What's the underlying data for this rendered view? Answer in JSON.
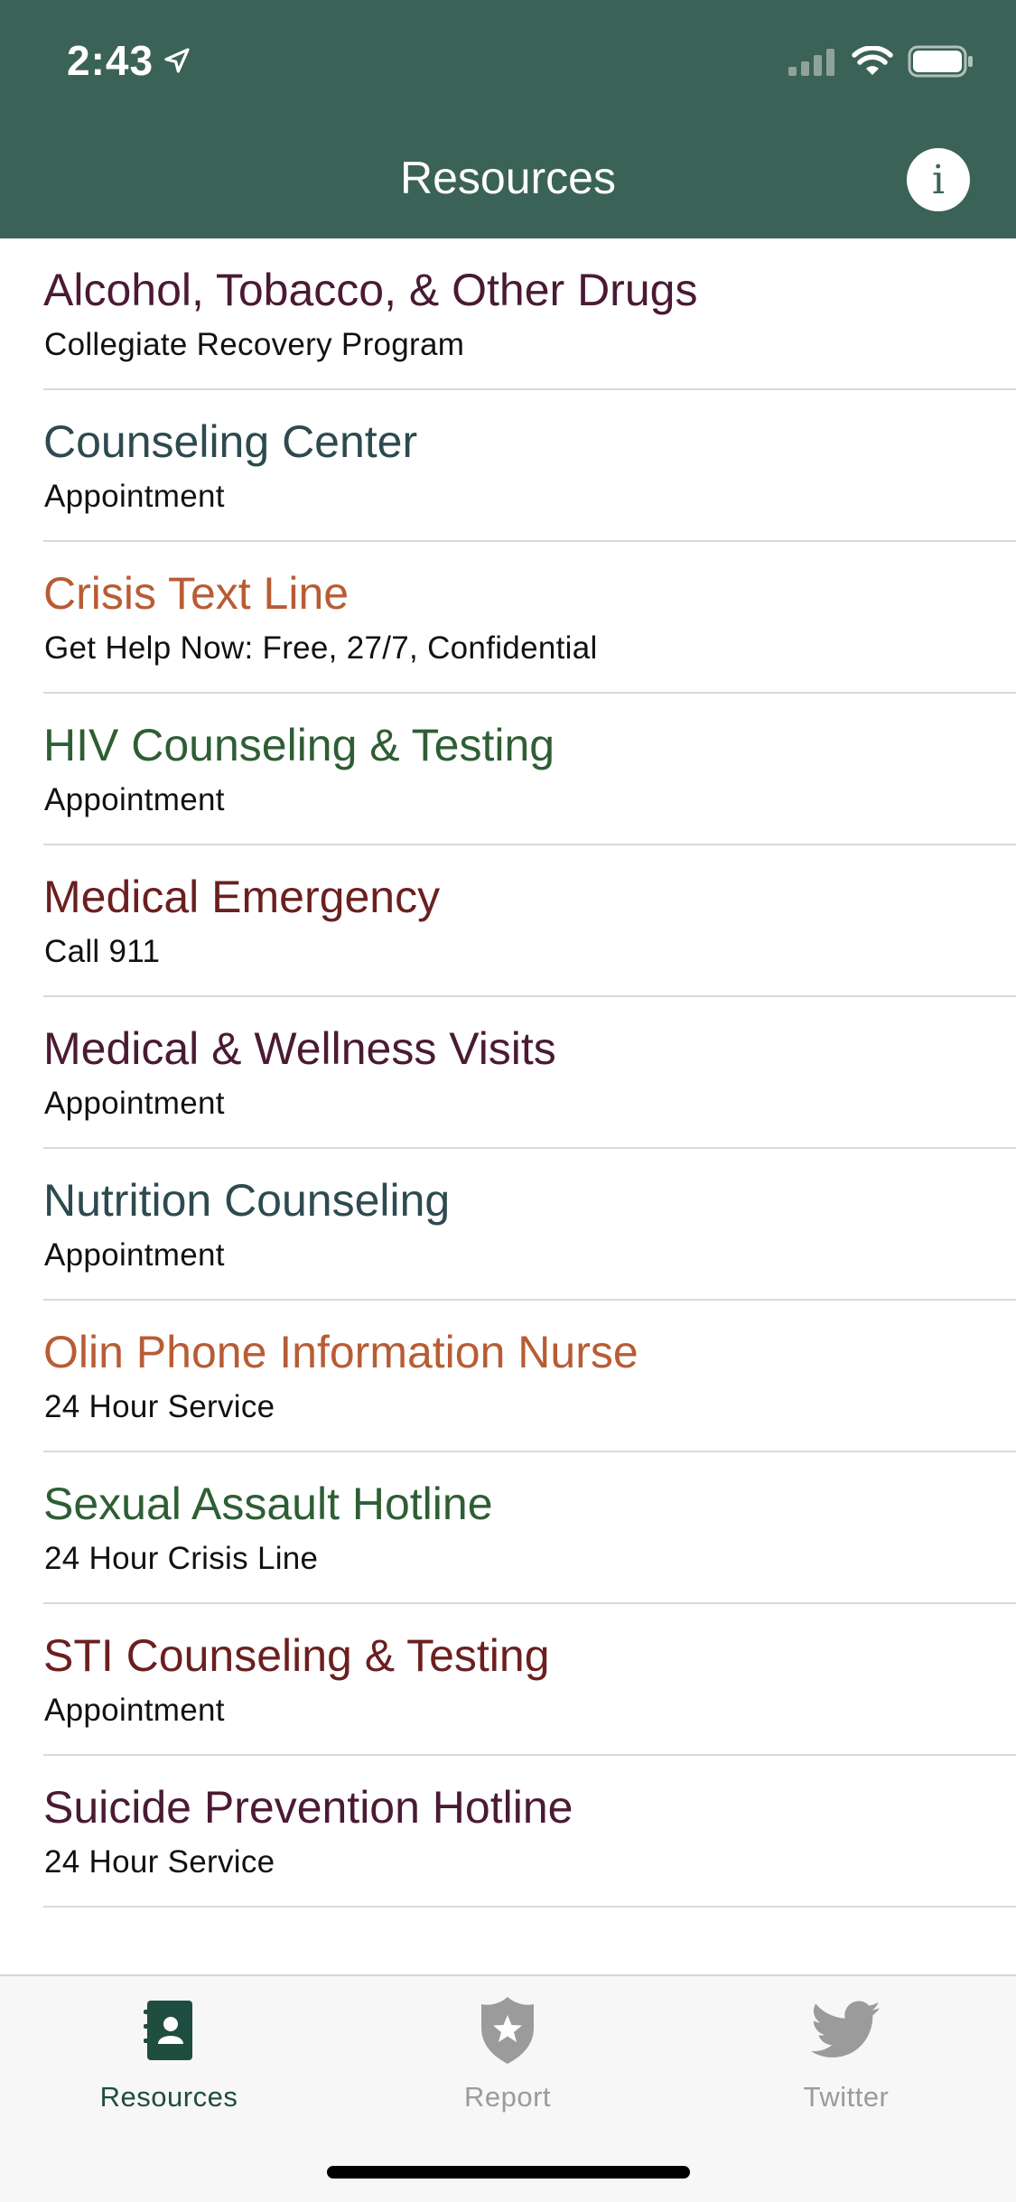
{
  "status_bar": {
    "time": "2:43"
  },
  "header": {
    "title": "Resources",
    "info_label": "i"
  },
  "colors": {
    "header_bg": "#3b6256",
    "purple": "#4a1a33",
    "slate": "#2d4a4f",
    "orange": "#b85c35",
    "green": "#2e5e34",
    "maroon": "#6b1f1f",
    "tab_active": "#1f4d3f",
    "tab_inactive": "#9b9b9b"
  },
  "resources": [
    {
      "title": "Alcohol, Tobacco, & Other Drugs",
      "subtitle": "Collegiate Recovery Program",
      "color": "#4a1a33"
    },
    {
      "title": "Counseling Center",
      "subtitle": "Appointment",
      "color": "#2d4a4f"
    },
    {
      "title": "Crisis Text Line",
      "subtitle": "Get Help Now: Free, 27/7, Confidential",
      "color": "#b85c35"
    },
    {
      "title": "HIV Counseling & Testing",
      "subtitle": "Appointment",
      "color": "#2e5e34"
    },
    {
      "title": "Medical Emergency",
      "subtitle": "Call 911",
      "color": "#6b1f1f"
    },
    {
      "title": "Medical & Wellness Visits",
      "subtitle": "Appointment",
      "color": "#4a1a33"
    },
    {
      "title": "Nutrition Counseling",
      "subtitle": "Appointment",
      "color": "#2d4a4f"
    },
    {
      "title": "Olin Phone Information Nurse",
      "subtitle": "24 Hour Service",
      "color": "#b85c35"
    },
    {
      "title": "Sexual Assault Hotline",
      "subtitle": "24 Hour Crisis Line",
      "color": "#2e5e34"
    },
    {
      "title": "STI Counseling & Testing",
      "subtitle": "Appointment",
      "color": "#6b1f1f"
    },
    {
      "title": "Suicide Prevention Hotline",
      "subtitle": "24 Hour Service",
      "color": "#4a1a33"
    }
  ],
  "tabs": [
    {
      "label": "Resources",
      "icon": "contact-book-icon",
      "active": true
    },
    {
      "label": "Report",
      "icon": "police-badge-icon",
      "active": false
    },
    {
      "label": "Twitter",
      "icon": "twitter-bird-icon",
      "active": false
    }
  ]
}
